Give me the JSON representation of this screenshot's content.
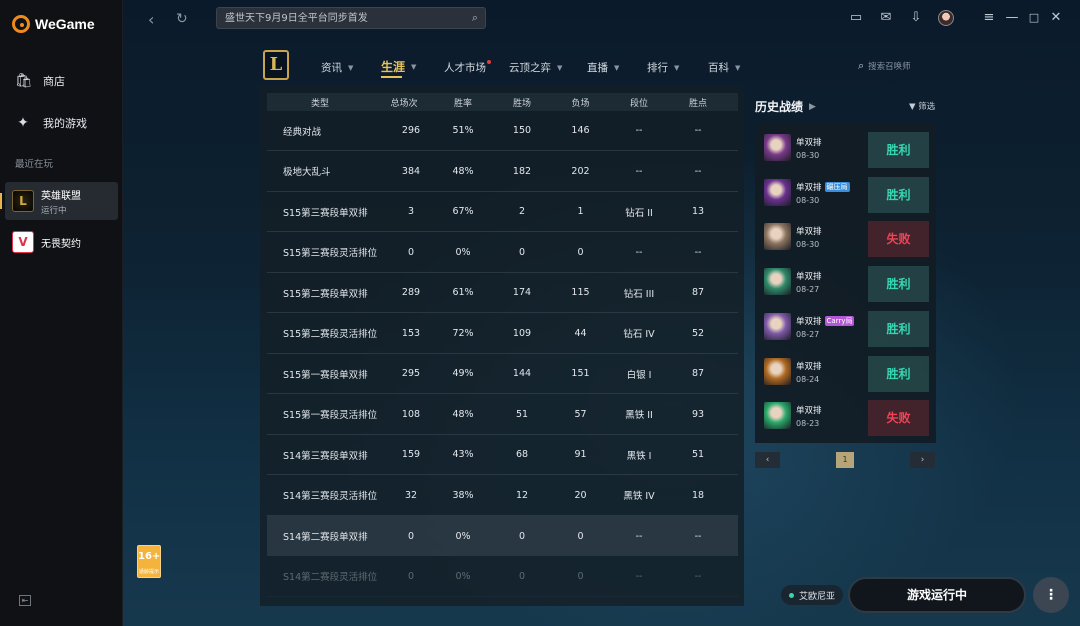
{
  "app": {
    "name": "WeGame"
  },
  "sidebar": {
    "items": [
      {
        "label": "商店",
        "icon": "store-icon"
      },
      {
        "label": "我的游戏",
        "icon": "games-icon"
      }
    ],
    "recent_label": "最近在玩",
    "games": [
      {
        "name": "英雄联盟",
        "status": "运行中",
        "icon": "lol-icon"
      },
      {
        "name": "无畏契约",
        "icon": "valorant-icon"
      }
    ]
  },
  "age_badge": {
    "rating": "16+",
    "label": "适龄提示"
  },
  "topbar": {
    "search_placeholder": "盛世天下9月9日全平台同步首发"
  },
  "game_nav": {
    "tabs": [
      {
        "label": "资讯",
        "caret": true
      },
      {
        "label": "生涯",
        "caret": true,
        "active": true
      },
      {
        "label": "人才市场",
        "dot": true
      },
      {
        "label": "云顶之弈",
        "caret": true
      },
      {
        "label": "直播",
        "caret": true
      },
      {
        "label": "排行",
        "caret": true
      },
      {
        "label": "百科",
        "caret": true
      }
    ],
    "summoner_search_placeholder": "搜索召唤师"
  },
  "stats_table": {
    "headers": [
      "类型",
      "总场次",
      "胜率",
      "胜场",
      "负场",
      "段位",
      "胜点"
    ],
    "rows": [
      [
        "经典对战",
        "296",
        "51%",
        "150",
        "146",
        "--",
        "--"
      ],
      [
        "极地大乱斗",
        "384",
        "48%",
        "182",
        "202",
        "--",
        "--"
      ],
      [
        "S15第三赛段单双排",
        "3",
        "67%",
        "2",
        "1",
        "钻石 II",
        "13"
      ],
      [
        "S15第三赛段灵活排位",
        "0",
        "0%",
        "0",
        "0",
        "--",
        "--"
      ],
      [
        "S15第二赛段单双排",
        "289",
        "61%",
        "174",
        "115",
        "钻石 III",
        "87"
      ],
      [
        "S15第二赛段灵活排位",
        "153",
        "72%",
        "109",
        "44",
        "钻石 IV",
        "52"
      ],
      [
        "S15第一赛段单双排",
        "295",
        "49%",
        "144",
        "151",
        "白银 I",
        "87"
      ],
      [
        "S15第一赛段灵活排位",
        "108",
        "48%",
        "51",
        "57",
        "黑铁 II",
        "93"
      ],
      [
        "S14第三赛段单双排",
        "159",
        "43%",
        "68",
        "91",
        "黑铁 I",
        "51"
      ],
      [
        "S14第三赛段灵活排位",
        "32",
        "38%",
        "12",
        "20",
        "黑铁 IV",
        "18"
      ],
      [
        "S14第二赛段单双排",
        "0",
        "0%",
        "0",
        "0",
        "--",
        "--"
      ],
      [
        "S14第二赛段灵活排位",
        "0",
        "0%",
        "0",
        "0",
        "--",
        "--"
      ]
    ]
  },
  "history": {
    "title": "历史战绩",
    "filter_label": "筛选",
    "matches": [
      {
        "mode": "单双排",
        "date": "08-30",
        "result": "胜利",
        "win": true,
        "color": "#7a3a8a"
      },
      {
        "mode": "单双排",
        "tag": "碾压局",
        "tag_style": "blue",
        "date": "08-30",
        "result": "胜利",
        "win": true,
        "color": "#6a3290"
      },
      {
        "mode": "单双排",
        "date": "08-30",
        "result": "失败",
        "win": false,
        "color": "#8a7460"
      },
      {
        "mode": "单双排",
        "date": "08-27",
        "result": "胜利",
        "win": true,
        "color": "#2f8a6a"
      },
      {
        "mode": "单双排",
        "tag": "Carry局",
        "tag_style": "purple",
        "date": "08-27",
        "result": "胜利",
        "win": true,
        "color": "#7e5aa8"
      },
      {
        "mode": "单双排",
        "date": "08-24",
        "result": "胜利",
        "win": true,
        "color": "#b06a22"
      },
      {
        "mode": "单双排",
        "date": "08-23",
        "result": "失败",
        "win": false,
        "color": "#2aa86a"
      }
    ],
    "page": "1"
  },
  "bottom": {
    "region": "艾欧尼亚",
    "run_label": "游戏运行中"
  }
}
